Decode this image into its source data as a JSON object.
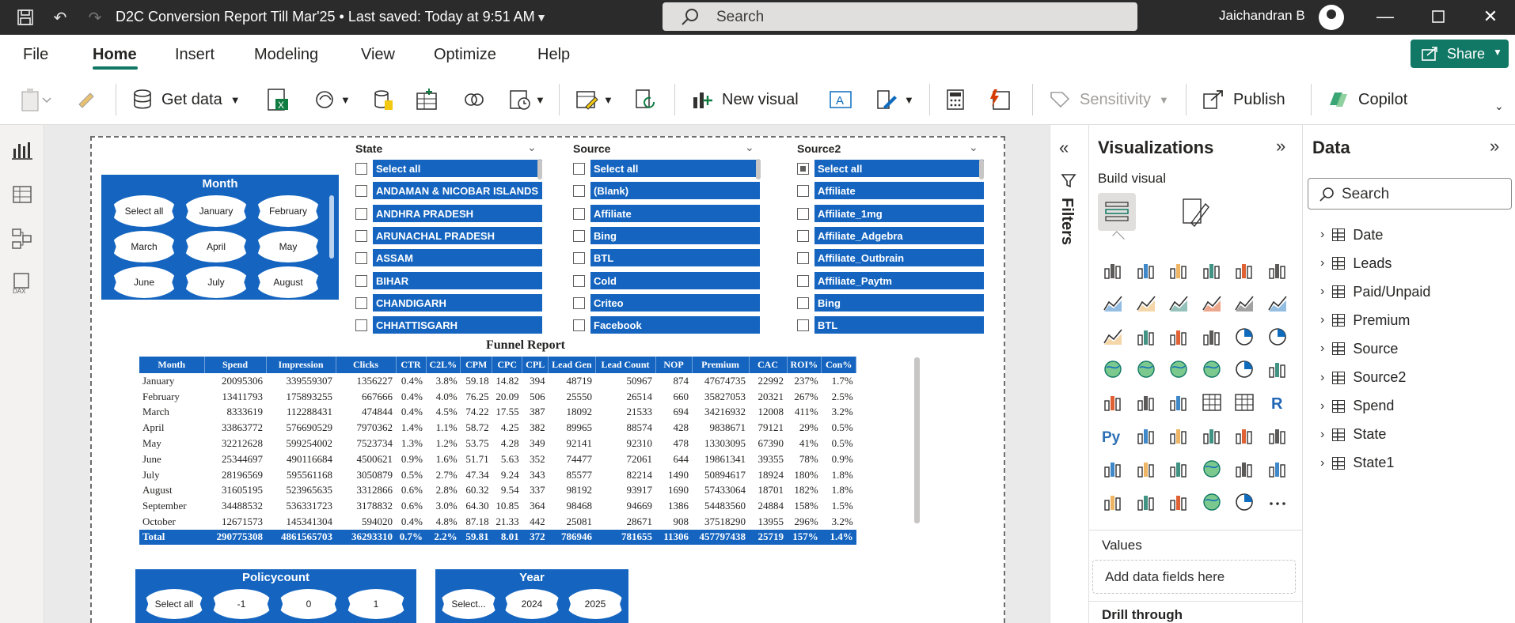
{
  "titlebar": {
    "title": "D2C Conversion Report Till Mar'25 • Last saved: Today at 9:51 AM",
    "search_placeholder": "Search",
    "user_name": "Jaichandran B"
  },
  "menu": [
    "File",
    "Home",
    "Insert",
    "Modeling",
    "View",
    "Optimize",
    "Help"
  ],
  "share_label": "Share",
  "ribbon": {
    "get_data": "Get data",
    "new_visual": "New visual",
    "sensitivity": "Sensitivity",
    "publish": "Publish",
    "copilot": "Copilot"
  },
  "month_slicer": {
    "title": "Month",
    "items": [
      "Select all",
      "January",
      "February",
      "March",
      "April",
      "May",
      "June",
      "July",
      "August"
    ]
  },
  "state_slicer": {
    "title": "State",
    "items": [
      "Select all",
      "ANDAMAN & NICOBAR ISLANDS",
      "ANDHRA PRADESH",
      "ARUNACHAL PRADESH",
      "ASSAM",
      "BIHAR",
      "CHANDIGARH",
      "CHHATTISGARH"
    ]
  },
  "source_slicer": {
    "title": "Source",
    "items": [
      "Select all",
      "(Blank)",
      "Affiliate",
      "Bing",
      "BTL",
      "Cold",
      "Criteo",
      "Facebook"
    ]
  },
  "source2_slicer": {
    "title": "Source2",
    "items": [
      "Select all",
      "Affiliate",
      "Affiliate_1mg",
      "Affiliate_Adgebra",
      "Affiliate_Outbrain",
      "Affiliate_Paytm",
      "Bing",
      "BTL"
    ]
  },
  "funnel": {
    "title": "Funnel Report",
    "columns": [
      "Month",
      "Spend",
      "Impression",
      "Clicks",
      "CTR",
      "C2L%",
      "CPM",
      "CPC",
      "CPL",
      "Lead Gen",
      "Lead Count",
      "NOP",
      "Premium",
      "CAC",
      "ROI%",
      "Con%"
    ],
    "rows": [
      [
        "January",
        "20095306",
        "339559307",
        "1356227",
        "0.4%",
        "3.8%",
        "59.18",
        "14.82",
        "394",
        "48719",
        "50967",
        "874",
        "47674735",
        "22992",
        "237%",
        "1.7%"
      ],
      [
        "February",
        "13411793",
        "175893255",
        "667666",
        "0.4%",
        "4.0%",
        "76.25",
        "20.09",
        "506",
        "25550",
        "26514",
        "660",
        "35827053",
        "20321",
        "267%",
        "2.5%"
      ],
      [
        "March",
        "8333619",
        "112288431",
        "474844",
        "0.4%",
        "4.5%",
        "74.22",
        "17.55",
        "387",
        "18092",
        "21533",
        "694",
        "34216932",
        "12008",
        "411%",
        "3.2%"
      ],
      [
        "April",
        "33863772",
        "576690529",
        "7970362",
        "1.4%",
        "1.1%",
        "58.72",
        "4.25",
        "382",
        "89965",
        "88574",
        "428",
        "9838671",
        "79121",
        "29%",
        "0.5%"
      ],
      [
        "May",
        "32212628",
        "599254002",
        "7523734",
        "1.3%",
        "1.2%",
        "53.75",
        "4.28",
        "349",
        "92141",
        "92310",
        "478",
        "13303095",
        "67390",
        "41%",
        "0.5%"
      ],
      [
        "June",
        "25344697",
        "490116684",
        "4500621",
        "0.9%",
        "1.6%",
        "51.71",
        "5.63",
        "352",
        "74477",
        "72061",
        "644",
        "19861341",
        "39355",
        "78%",
        "0.9%"
      ],
      [
        "July",
        "28196569",
        "595561168",
        "3050879",
        "0.5%",
        "2.7%",
        "47.34",
        "9.24",
        "343",
        "85577",
        "82214",
        "1490",
        "50894617",
        "18924",
        "180%",
        "1.8%"
      ],
      [
        "August",
        "31605195",
        "523965635",
        "3312866",
        "0.6%",
        "2.8%",
        "60.32",
        "9.54",
        "337",
        "98192",
        "93917",
        "1690",
        "57433064",
        "18701",
        "182%",
        "1.8%"
      ],
      [
        "September",
        "34488532",
        "536331723",
        "3178832",
        "0.6%",
        "3.0%",
        "64.30",
        "10.85",
        "364",
        "98468",
        "94669",
        "1386",
        "54483560",
        "24884",
        "158%",
        "1.5%"
      ],
      [
        "October",
        "12671573",
        "145341304",
        "594020",
        "0.4%",
        "4.8%",
        "87.18",
        "21.33",
        "442",
        "25081",
        "28671",
        "908",
        "37518290",
        "13955",
        "296%",
        "3.2%"
      ]
    ],
    "total": [
      "Total",
      "290775308",
      "4861565703",
      "36293310",
      "0.7%",
      "2.2%",
      "59.81",
      "8.01",
      "372",
      "786946",
      "781655",
      "11306",
      "457797438",
      "25719",
      "157%",
      "1.4%"
    ]
  },
  "policy_slicer": {
    "title": "Policycount",
    "items": [
      "Select all",
      "-1",
      "0",
      "1"
    ]
  },
  "year_slicer": {
    "title": "Year",
    "items": [
      "Select...",
      "2024",
      "2025"
    ]
  },
  "filters_label": "Filters",
  "viz": {
    "title": "Visualizations",
    "build_visual": "Build visual",
    "values_label": "Values",
    "values_placeholder": "Add data fields here",
    "drill_through": "Drill through"
  },
  "data_pane": {
    "title": "Data",
    "search_placeholder": "Search",
    "fields": [
      "Date",
      "Leads",
      "Paid/Unpaid",
      "Premium",
      "Source",
      "Source2",
      "Spend",
      "State",
      "State1"
    ]
  },
  "colors": {
    "accent": "#117865",
    "slicer_blue": "#1565c0"
  }
}
